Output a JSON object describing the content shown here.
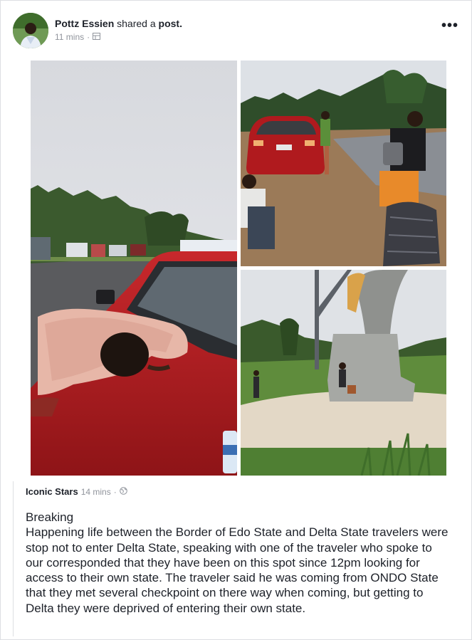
{
  "post": {
    "author": "Pottz Essien",
    "action": "shared a",
    "object": "post.",
    "time": "11 mins",
    "separator": "·",
    "privacy_icon": "album-icon",
    "more_label": "•••"
  },
  "photos": [
    {
      "name": "photo-man-on-car-hood",
      "icon": "photo"
    },
    {
      "name": "photo-travelers-by-red-car",
      "icon": "photo"
    },
    {
      "name": "photo-border-monument",
      "icon": "photo"
    }
  ],
  "shared_post": {
    "author": "Iconic Stars",
    "time": "14 mins",
    "separator": "·",
    "privacy_icon": "globe-icon",
    "headline": "Breaking",
    "body": "Happening life between the Border of Edo State and Delta State travelers were stop not to enter Delta State, speaking with one of the traveler who spoke to our corresponded that they have been on this spot since 12pm looking for access to their own state. The traveler said he was coming from ONDO State that they met several checkpoint on there way when coming, but getting to Delta they were deprived of entering their own state."
  },
  "colors": {
    "text": "#1d2129",
    "meta": "#90949c",
    "border": "#dddfe2",
    "car_red": "#b01a1e"
  }
}
